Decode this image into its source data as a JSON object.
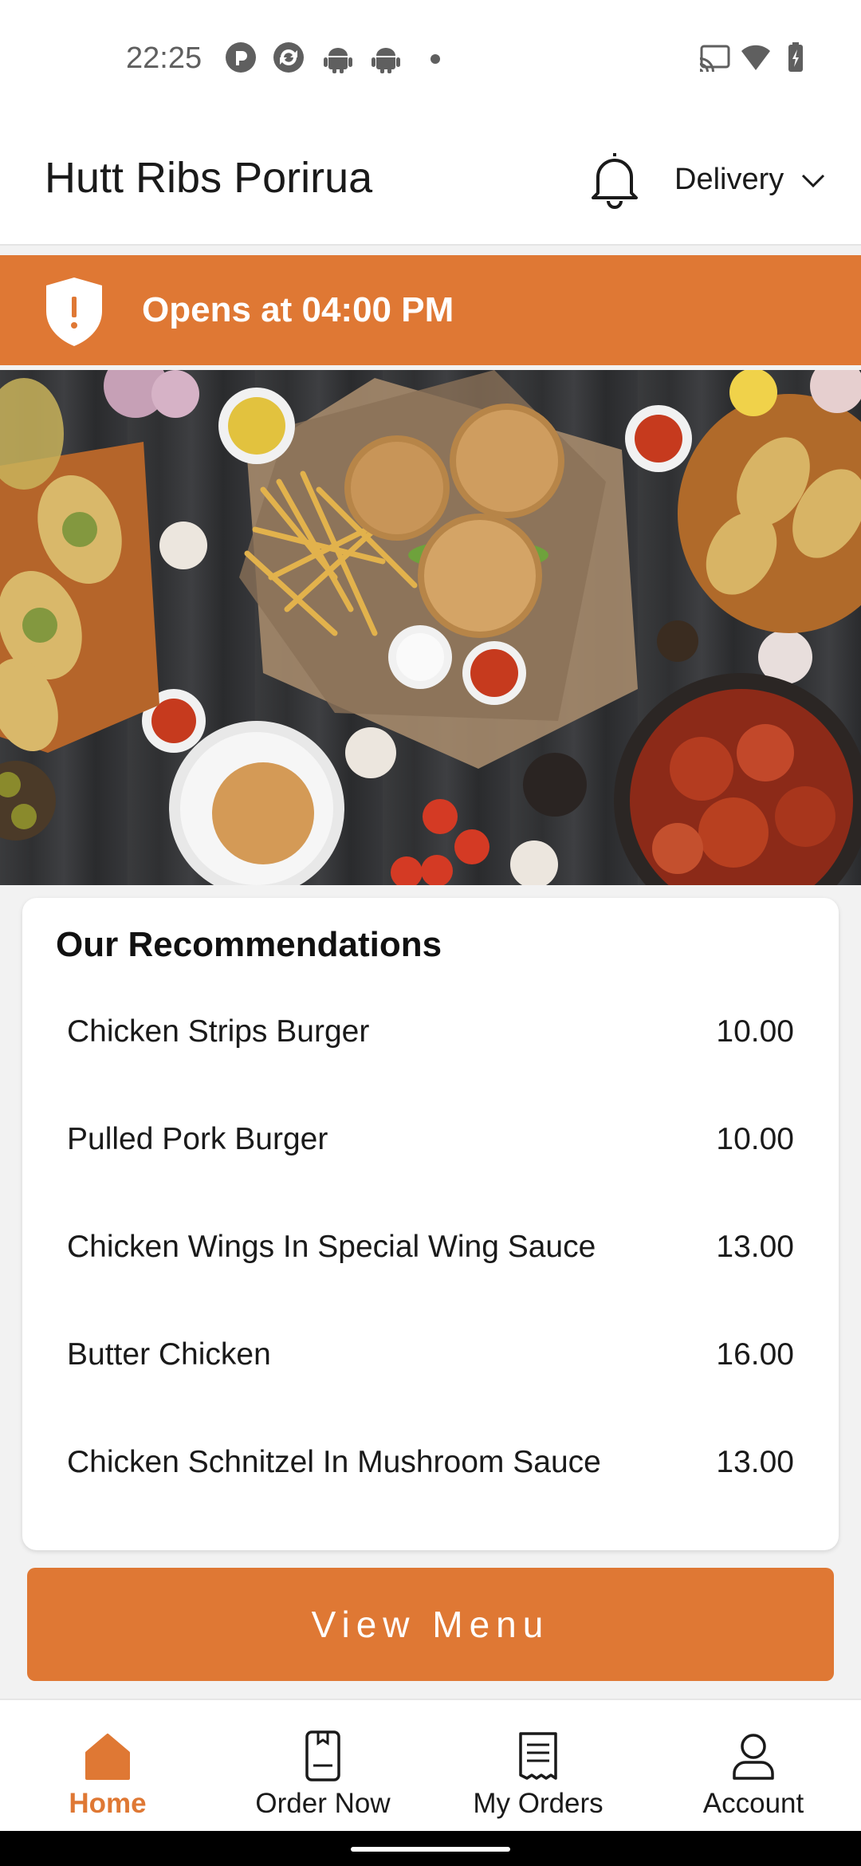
{
  "status_bar": {
    "time": "22:25",
    "left_icons": [
      "pocket-casts-icon",
      "sync-icon",
      "android-icon",
      "android-icon",
      "dot-icon"
    ],
    "right_icons": [
      "cast-icon",
      "wifi-icon",
      "battery-charging-icon"
    ]
  },
  "header": {
    "title": "Hutt Ribs Porirua",
    "notification_icon": "bell-icon",
    "order_mode": "Delivery",
    "order_mode_icon": "chevron-down-icon"
  },
  "banner": {
    "icon": "shield-alert-icon",
    "text": "Opens at 04:00 PM"
  },
  "hero": {
    "image": "food-spread-image"
  },
  "recommendations": {
    "title": "Our Recommendations",
    "items": [
      {
        "name": "Chicken Strips Burger",
        "price": "10.00"
      },
      {
        "name": "Pulled Pork Burger",
        "price": "10.00"
      },
      {
        "name": "Chicken Wings In Special Wing Sauce",
        "price": "13.00"
      },
      {
        "name": "Butter Chicken",
        "price": "16.00"
      },
      {
        "name": "Chicken Schnitzel In Mushroom Sauce",
        "price": "13.00"
      }
    ]
  },
  "view_menu": {
    "label": "View Menu"
  },
  "bottom_nav": {
    "items": [
      {
        "label": "Home",
        "icon": "home-icon",
        "active": true
      },
      {
        "label": "Order Now",
        "icon": "order-device-icon",
        "active": false
      },
      {
        "label": "My Orders",
        "icon": "receipt-icon",
        "active": false
      },
      {
        "label": "Account",
        "icon": "account-icon",
        "active": false
      }
    ]
  },
  "colors": {
    "accent": "#df7834",
    "text": "#1a1a1a",
    "background": "#f2f2f2"
  }
}
